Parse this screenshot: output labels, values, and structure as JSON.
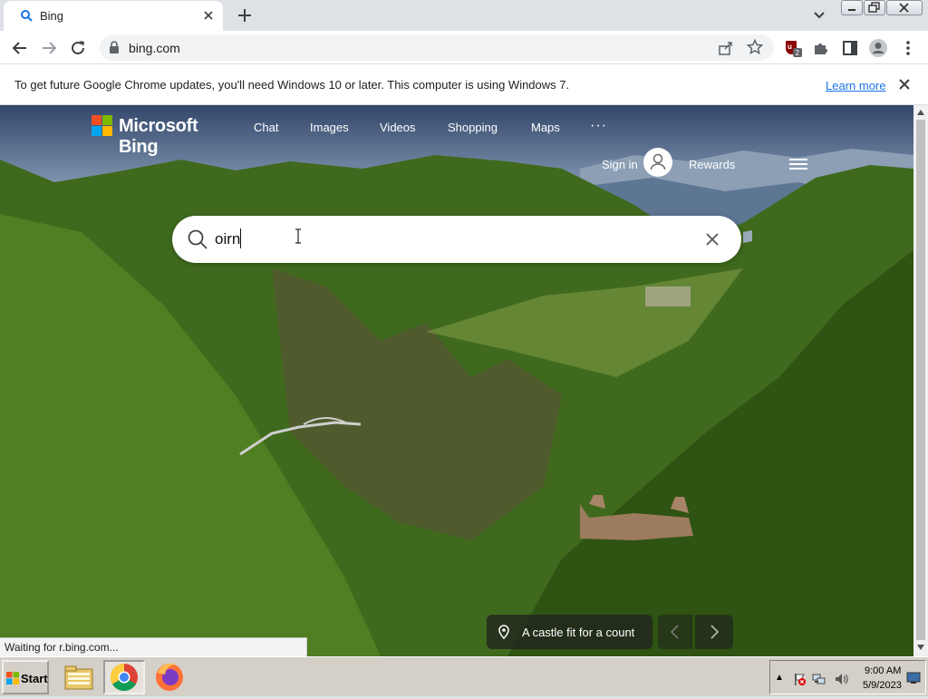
{
  "browser": {
    "tab": {
      "title": "Bing",
      "favicon": "bing-search-icon"
    },
    "address": {
      "url": "bing.com"
    },
    "infobar": {
      "message": "To get future Google Chrome updates, you'll need Windows 10 or later. This computer is using Windows 7.",
      "link": "Learn more"
    },
    "extension_badge": "2",
    "status": "Waiting for r.bing.com..."
  },
  "bing": {
    "logo_text": "Microsoft Bing",
    "nav": [
      "Chat",
      "Images",
      "Videos",
      "Shopping",
      "Maps"
    ],
    "nav_more": "···",
    "sign_in": "Sign in",
    "rewards": "Rewards",
    "search": {
      "query": "oirn"
    },
    "caption": "A castle fit for a count"
  },
  "taskbar": {
    "start_label": "Start",
    "apps": [
      "file-explorer-icon",
      "chrome-icon",
      "firefox-icon"
    ],
    "clock": {
      "time": "9:00 AM",
      "date": "5/9/2023"
    }
  },
  "colors": {
    "chrome_accent": "#1a73e8",
    "ms_red": "#f25022",
    "ms_green": "#7fba00",
    "ms_blue": "#00a4ef",
    "ms_yellow": "#ffb900"
  }
}
